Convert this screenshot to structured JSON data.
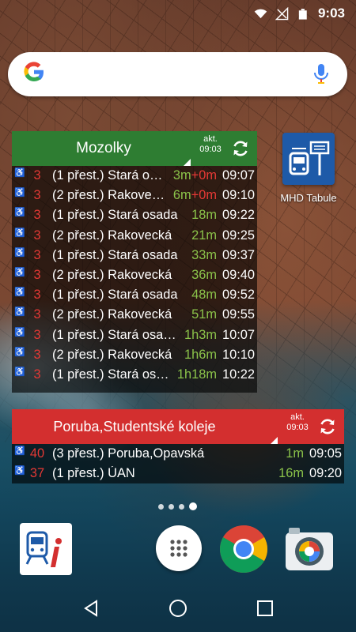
{
  "status_bar": {
    "time": "9:03"
  },
  "search": {
    "logo": "G"
  },
  "widgets": [
    {
      "title": "Mozolky",
      "color": "#2e7d32",
      "akt_label": "akt.",
      "akt_time": "09:03",
      "rows": [
        {
          "line": "3",
          "dest": "(1 přest.) Stará o…",
          "mins": "3m",
          "delay": "+0m",
          "time": "09:07"
        },
        {
          "line": "3",
          "dest": "(2 přest.) Rakove…",
          "mins": "6m",
          "delay": "+0m",
          "time": "09:10"
        },
        {
          "line": "3",
          "dest": "(1 přest.) Stará osada",
          "mins": "18m",
          "delay": "",
          "time": "09:22"
        },
        {
          "line": "3",
          "dest": "(2 přest.) Rakovecká",
          "mins": "21m",
          "delay": "",
          "time": "09:25"
        },
        {
          "line": "3",
          "dest": "(1 přest.) Stará osada",
          "mins": "33m",
          "delay": "",
          "time": "09:37"
        },
        {
          "line": "3",
          "dest": "(2 přest.) Rakovecká",
          "mins": "36m",
          "delay": "",
          "time": "09:40"
        },
        {
          "line": "3",
          "dest": "(1 přest.) Stará osada",
          "mins": "48m",
          "delay": "",
          "time": "09:52"
        },
        {
          "line": "3",
          "dest": "(2 přest.) Rakovecká",
          "mins": "51m",
          "delay": "",
          "time": "09:55"
        },
        {
          "line": "3",
          "dest": "(1 přest.) Stará osa…",
          "mins": "1h3m",
          "delay": "",
          "time": "10:07"
        },
        {
          "line": "3",
          "dest": "(2 přest.) Rakovecká",
          "mins": "1h6m",
          "delay": "",
          "time": "10:10"
        },
        {
          "line": "3",
          "dest": "(1 přest.) Stará os…",
          "mins": "1h18m",
          "delay": "",
          "time": "10:22"
        }
      ]
    },
    {
      "title": "Poruba,Studentské koleje",
      "color": "#d32f2f",
      "akt_label": "akt.",
      "akt_time": "09:03",
      "rows": [
        {
          "line": "40",
          "dest": "(3 přest.) Poruba,Opavská",
          "mins": "1m",
          "delay": "",
          "time": "09:05"
        },
        {
          "line": "37",
          "dest": "(1 přest.) ÚAN",
          "mins": "16m",
          "delay": "",
          "time": "09:20"
        }
      ]
    }
  ],
  "home_apps": {
    "mhd_label": "MHD Tabule"
  },
  "icons": {
    "wifi": "wifi-icon",
    "signal": "signal-icon",
    "battery": "battery-icon",
    "mic": "mic-icon",
    "refresh": "refresh-icon",
    "wheelchair": "♿"
  }
}
